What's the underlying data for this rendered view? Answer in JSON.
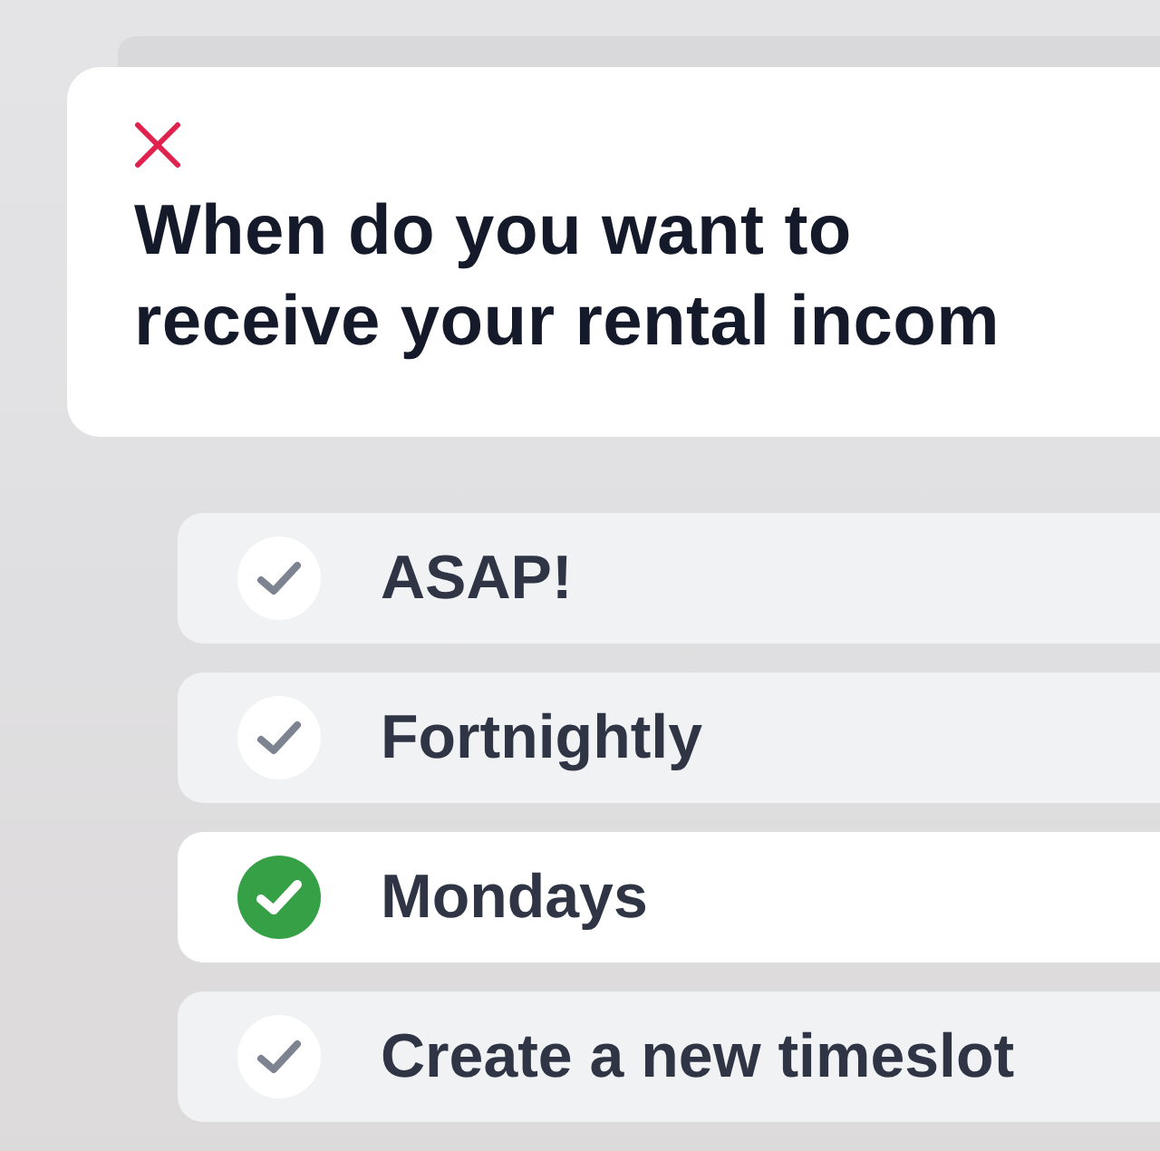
{
  "dialog": {
    "title": "When do you want to receive your rental incom"
  },
  "options": [
    {
      "label": "ASAP!",
      "selected": false
    },
    {
      "label": "Fortnightly",
      "selected": false
    },
    {
      "label": "Mondays",
      "selected": true
    },
    {
      "label": "Create a new timeslot",
      "selected": false
    }
  ]
}
